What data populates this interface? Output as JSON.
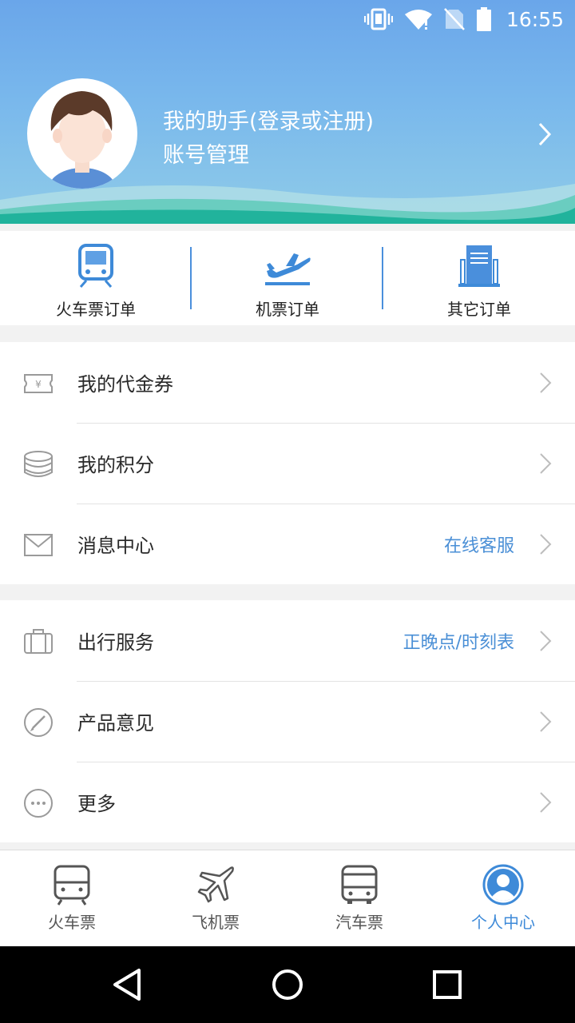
{
  "status_bar": {
    "time": "16:55",
    "icons": [
      "vibrate-icon",
      "wifi-icon",
      "no-sim-icon",
      "battery-icon"
    ]
  },
  "profile": {
    "name": "我的助手(登录或注册)",
    "subtitle": "账号管理"
  },
  "orders": [
    {
      "label": "火车票订单",
      "icon": "train-icon"
    },
    {
      "label": "机票订单",
      "icon": "plane-takeoff-icon"
    },
    {
      "label": "其它订单",
      "icon": "document-icon"
    }
  ],
  "section1": [
    {
      "label": "我的代金券",
      "extra": "",
      "icon": "voucher-icon"
    },
    {
      "label": "我的积分",
      "extra": "",
      "icon": "coins-icon"
    },
    {
      "label": "消息中心",
      "extra": "在线客服",
      "icon": "envelope-icon"
    }
  ],
  "section2": [
    {
      "label": "出行服务",
      "extra": "正晚点/时刻表",
      "icon": "luggage-icon"
    },
    {
      "label": "产品意见",
      "extra": "",
      "icon": "edit-icon"
    },
    {
      "label": "更多",
      "extra": "",
      "icon": "more-icon"
    }
  ],
  "bottom_nav": [
    {
      "label": "火车票",
      "icon": "train-nav-icon",
      "active": false
    },
    {
      "label": "飞机票",
      "icon": "plane-nav-icon",
      "active": false
    },
    {
      "label": "汽车票",
      "icon": "bus-nav-icon",
      "active": false
    },
    {
      "label": "个人中心",
      "icon": "user-nav-icon",
      "active": true
    }
  ],
  "colors": {
    "accent": "#3e8ad8",
    "header_top": "#6aa6ea",
    "header_bottom": "#8fcbe8",
    "wave": "#2fb8a8"
  }
}
